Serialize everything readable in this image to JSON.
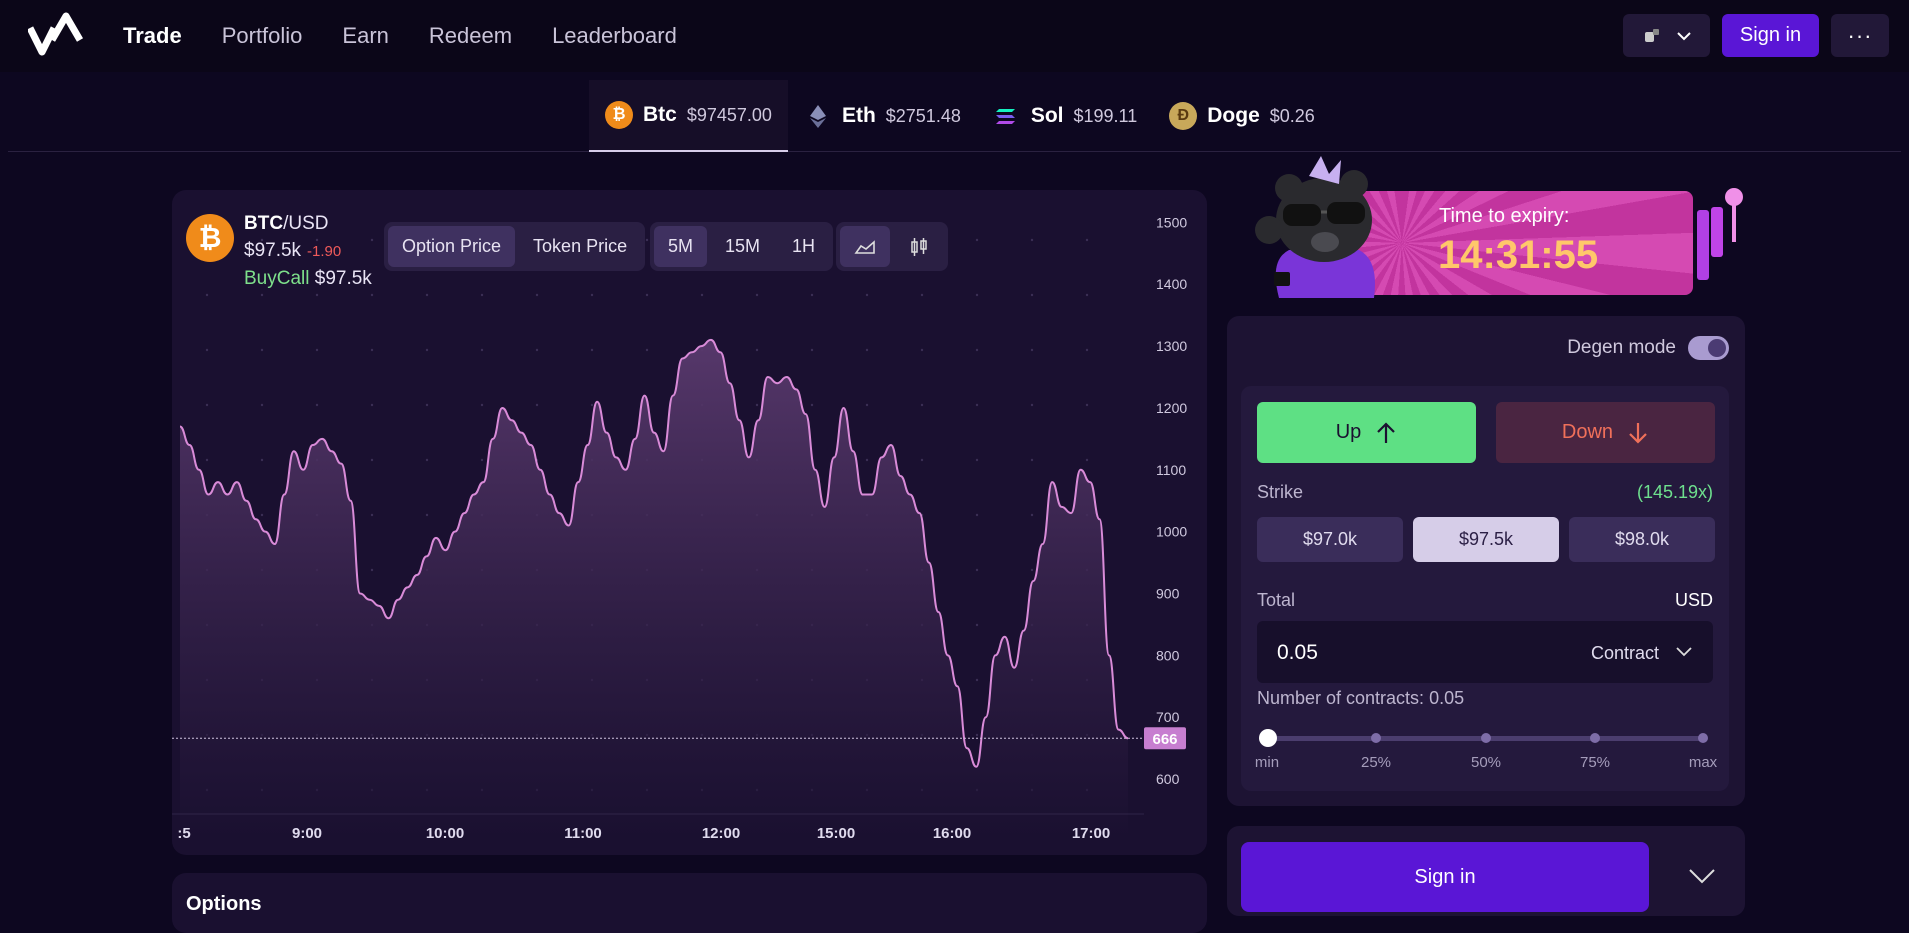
{
  "nav": {
    "items": [
      "Trade",
      "Portfolio",
      "Earn",
      "Redeem",
      "Leaderboard"
    ],
    "active": "Trade"
  },
  "topbar": {
    "signin_label": "Sign in",
    "more_label": "···"
  },
  "tickers": [
    {
      "symbol": "Btc",
      "price": "$97457.00",
      "active": true
    },
    {
      "symbol": "Eth",
      "price": "$2751.48"
    },
    {
      "symbol": "Sol",
      "price": "$199.11"
    },
    {
      "symbol": "Doge",
      "price": "$0.26"
    }
  ],
  "chart_header": {
    "base": "BTC",
    "quote": "/USD",
    "price": "$97.5k",
    "change": "-1.90",
    "side": "BuyCall",
    "side_price": "$97.5k",
    "price_tabs": [
      "Option Price",
      "Token Price"
    ],
    "time_tabs": [
      "5M",
      "15M",
      "1H"
    ]
  },
  "chart_data": {
    "type": "area",
    "x_ticks": [
      ":5",
      "9:00",
      "10:00",
      "11:00",
      "12:00",
      "15:00",
      "16:00",
      "17:00"
    ],
    "ylim": [
      550,
      1520
    ],
    "y_ticks": [
      1500,
      1400,
      1300,
      1200,
      1100,
      1000,
      900,
      800,
      700,
      600
    ],
    "current_value": "666",
    "colors": {
      "line": "#d98bd8",
      "fill_top": "#5a3a6e",
      "fill_bottom": "#1a1030"
    },
    "values": [
      1170,
      1140,
      1100,
      1060,
      1080,
      1060,
      1080,
      1050,
      1020,
      1000,
      980,
      1060,
      1130,
      1100,
      1140,
      1150,
      1130,
      1110,
      1050,
      900,
      890,
      880,
      860,
      890,
      910,
      930,
      960,
      990,
      970,
      1000,
      1030,
      1060,
      1080,
      1150,
      1200,
      1180,
      1160,
      1140,
      1100,
      1060,
      1030,
      1010,
      1080,
      1140,
      1210,
      1160,
      1120,
      1100,
      1150,
      1220,
      1160,
      1130,
      1220,
      1280,
      1290,
      1300,
      1310,
      1290,
      1240,
      1180,
      1120,
      1180,
      1250,
      1240,
      1250,
      1230,
      1190,
      1100,
      1040,
      1120,
      1200,
      1130,
      1060,
      1060,
      1120,
      1140,
      1090,
      1060,
      1030,
      950,
      870,
      800,
      750,
      650,
      620,
      700,
      800,
      830,
      780,
      840,
      920,
      980,
      1080,
      1040,
      1030,
      1100,
      1080,
      1020,
      800,
      680,
      666
    ]
  },
  "expiry": {
    "label": "Time to expiry:",
    "time": "14:31:55"
  },
  "trade": {
    "degen_label": "Degen mode",
    "up_label": "Up",
    "down_label": "Down",
    "strike_label": "Strike",
    "multiplier": "(145.19x)",
    "strikes": [
      "$97.0k",
      "$97.5k",
      "$98.0k"
    ],
    "selected_strike": "$97.5k",
    "total_label": "Total",
    "currency": "USD",
    "amount": "0.05",
    "unit": "Contract",
    "contracts_text": "Number of contracts: 0.05",
    "slider_ticks": [
      "min",
      "25%",
      "50%",
      "75%",
      "max"
    ],
    "slider_value": 0
  },
  "bottom": {
    "signin_label": "Sign in"
  },
  "options": {
    "title": "Options"
  }
}
